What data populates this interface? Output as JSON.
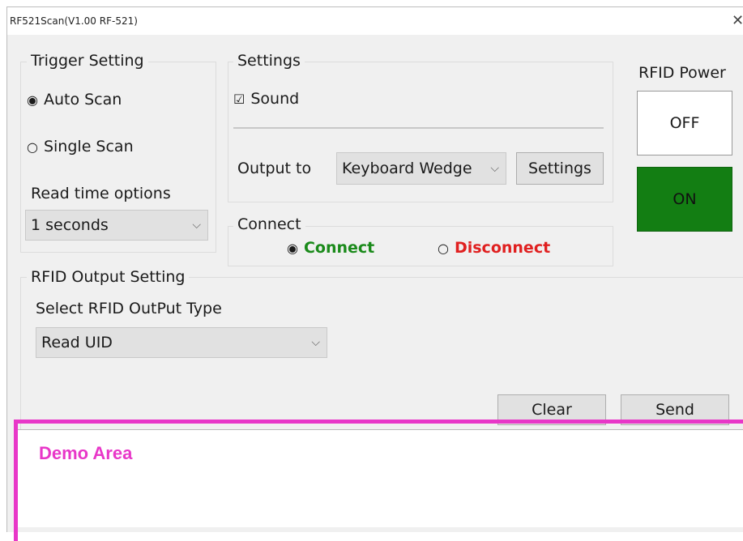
{
  "window": {
    "title": "RF521Scan(V1.00 RF-521)"
  },
  "trigger": {
    "legend": "Trigger Setting",
    "auto_scan": "Auto Scan",
    "single_scan": "Single Scan",
    "selected": "auto_scan",
    "read_time_label": "Read time options",
    "read_time_value": "1 seconds"
  },
  "settings": {
    "legend": "Settings",
    "sound_label": "Sound",
    "sound_checked": true,
    "output_label": "Output to",
    "output_value": "Keyboard Wedge",
    "settings_button": "Settings"
  },
  "power": {
    "label": "RFID Power",
    "off_label": "OFF",
    "on_label": "ON",
    "on_color": "#137e13"
  },
  "connect": {
    "legend": "Connect",
    "connect_label": "Connect",
    "disconnect_label": "Disconnect",
    "selected": "connect",
    "connect_color": "#1a8a1a",
    "disconnect_color": "#e02020"
  },
  "output": {
    "legend": "RFID Output Setting",
    "type_label": "Select RFID OutPut Type",
    "type_value": "Read UID"
  },
  "actions": {
    "clear": "Clear",
    "send": "Send"
  },
  "demo": {
    "label": "Demo Area",
    "highlight_color": "#e837c8"
  }
}
